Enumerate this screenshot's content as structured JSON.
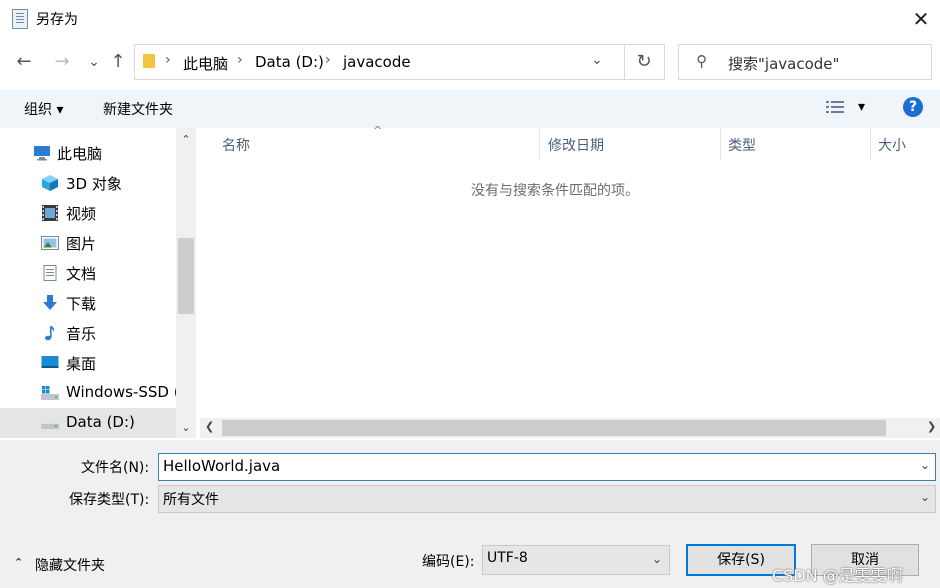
{
  "window": {
    "title": "另存为",
    "close_glyph": "✕"
  },
  "nav": {
    "back": "←",
    "forward": "→",
    "recent": "⌄",
    "up": "↑",
    "breadcrumbs": [
      "此电脑",
      "Data (D:)",
      "javacode"
    ],
    "separator": "›",
    "dropdown": "⌄",
    "refresh": "↻",
    "search_placeholder": "搜索\"javacode\""
  },
  "toolbar": {
    "organize": "组织 ▾",
    "new_folder": "新建文件夹",
    "view_dropdown": "▾",
    "help": "?"
  },
  "sidebar": {
    "items": [
      {
        "label": "此电脑",
        "icon": "computer-icon"
      },
      {
        "label": "3D 对象",
        "icon": "cube-icon"
      },
      {
        "label": "视频",
        "icon": "video-icon"
      },
      {
        "label": "图片",
        "icon": "picture-icon"
      },
      {
        "label": "文档",
        "icon": "document-icon"
      },
      {
        "label": "下载",
        "icon": "download-icon"
      },
      {
        "label": "音乐",
        "icon": "music-icon"
      },
      {
        "label": "桌面",
        "icon": "desktop-icon"
      },
      {
        "label": "Windows-SSD (",
        "icon": "windows-drive-icon"
      },
      {
        "label": "Data (D:)",
        "icon": "drive-icon",
        "selected": true
      }
    ]
  },
  "filelist": {
    "columns": [
      "名称",
      "修改日期",
      "类型",
      "大小"
    ],
    "sort_indicator": "^",
    "empty_message": "没有与搜索条件匹配的项。"
  },
  "form": {
    "filename_label": "文件名(N):",
    "filename_value": "HelloWorld.java",
    "filetype_label": "保存类型(T):",
    "filetype_value": "所有文件",
    "encoding_label": "编码(E):",
    "encoding_value": "UTF-8",
    "hide_folders": "隐藏文件夹",
    "save_button": "保存(S)",
    "cancel_button": "取消"
  },
  "watermark": "CSDN @是雯雯啊",
  "colors": {
    "accent": "#0078d7",
    "help": "#1c6fd1",
    "toolbar_bg": "#f0f5fa"
  }
}
